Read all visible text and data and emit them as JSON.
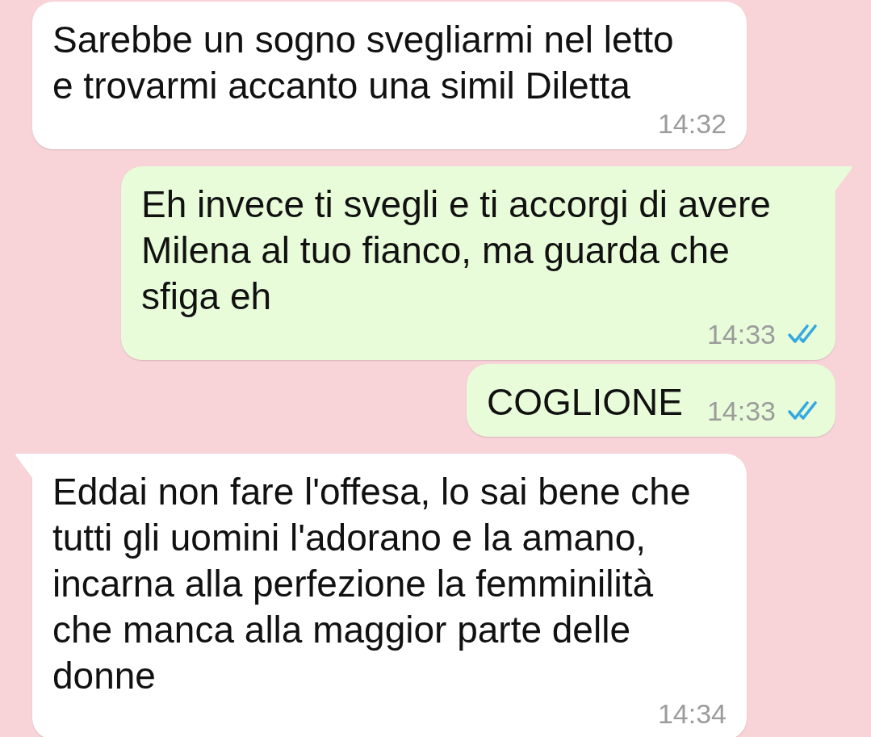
{
  "chat": {
    "messages": [
      {
        "kind": "incoming",
        "tail": false,
        "text": "Sarebbe un sogno svegliarmi nel letto\ne trovarmi accanto una simil Diletta",
        "time": "14:32"
      },
      {
        "kind": "outgoing",
        "tail": true,
        "text": "Eh invece ti svegli e ti accorgi di avere\nMilena al tuo fianco, ma guarda che\nsfiga eh",
        "time": "14:33",
        "read": true
      },
      {
        "kind": "outgoing",
        "tail": false,
        "text": "COGLIONE",
        "time": "14:33",
        "read": true
      },
      {
        "kind": "incoming",
        "tail": true,
        "text": "Eddai non fare l'offesa, lo sai bene che\ntutti gli uomini l'adorano e la amano,\nincarna alla perfezione la femminilità\nche manca alla maggior parte delle\ndonne",
        "time": "14:34"
      }
    ]
  }
}
